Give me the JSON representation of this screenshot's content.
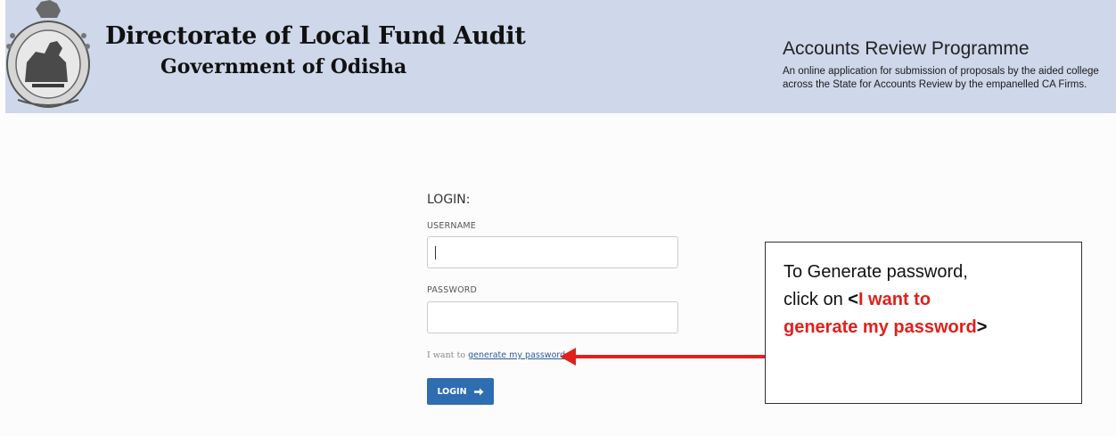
{
  "header": {
    "org_title": "Directorate of Local Fund Audit",
    "org_subtitle": "Government of Odisha",
    "programme_title": "Accounts Review Programme",
    "programme_desc_line1": "An online application for submission of proposals by the aided college",
    "programme_desc_line2": "across the State for  Accounts Review by the empanelled CA Firms.",
    "emblem_icon": "odisha-emblem-icon",
    "band_color": "#cfd8ea"
  },
  "login": {
    "heading": "LOGIN:",
    "username_label": "USERNAME",
    "username_value": "",
    "password_label": "PASSWORD",
    "password_value": "",
    "generate_prefix": "I want to ",
    "generate_link": "generate my password",
    "button_label": "LOGIN",
    "button_icon": "arrow-right-icon",
    "button_color": "#2f6db3"
  },
  "callout": {
    "line1": "To Generate password,",
    "line2_prefix": "click on ",
    "open_bracket": "<",
    "highlight_1": "I want to",
    "highlight_2": "generate my password",
    "close_bracket": ">",
    "highlight_color": "#e0201c",
    "arrow_color": "#e0201c"
  }
}
